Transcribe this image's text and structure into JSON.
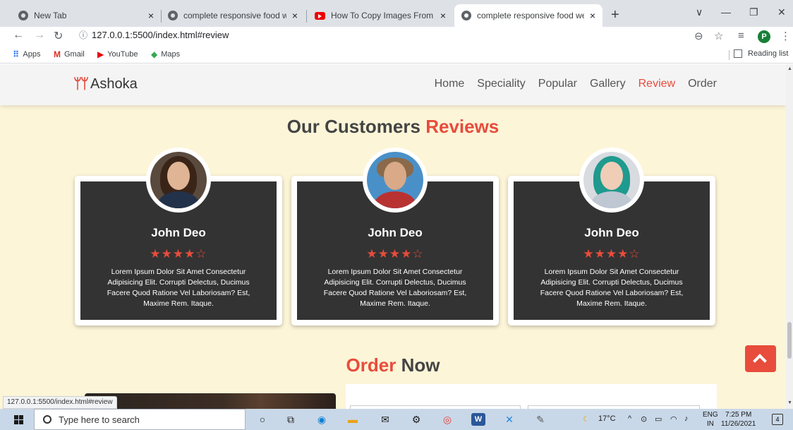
{
  "browser": {
    "tabs": [
      {
        "title": "New Tab",
        "close": "×"
      },
      {
        "title": "complete responsive food websi",
        "close": "×"
      },
      {
        "title": "How To Copy Images From Word",
        "close": "×"
      },
      {
        "title": "complete responsive food websi",
        "close": "×"
      }
    ],
    "new_tab": "+",
    "window_controls": {
      "tab_search": "∨",
      "minimize": "—",
      "restore": "❐",
      "close": "✕"
    },
    "address": "127.0.0.1:5500/index.html#review",
    "bookmarks": [
      {
        "label": "Apps",
        "icon": "apps-grid-icon"
      },
      {
        "label": "Gmail",
        "icon": "gmail-icon"
      },
      {
        "label": "YouTube",
        "icon": "youtube-icon"
      },
      {
        "label": "Maps",
        "icon": "maps-icon"
      }
    ],
    "reading_list": "Reading list",
    "profile_initial": "P",
    "status_url": "127.0.0.1:5500/index.html#review"
  },
  "site": {
    "logo": "Ashoka",
    "menu": [
      "Home",
      "Speciality",
      "Popular",
      "Gallery",
      "Review",
      "Order"
    ],
    "active_menu": "Review",
    "accent_color": "#e74c3c",
    "review_heading": {
      "prefix": "Our Customers",
      "accent": "Reviews"
    },
    "reviews": [
      {
        "name": "John Deo",
        "rating": 4,
        "text": "Lorem Ipsum Dolor Sit Amet Consectetur Adipisicing Elit. Corrupti Delectus, Ducimus Facere Quod Ratione Vel Laboriosam? Est, Maxime Rem. Itaque."
      },
      {
        "name": "John Deo",
        "rating": 4,
        "text": "Lorem Ipsum Dolor Sit Amet Consectetur Adipisicing Elit. Corrupti Delectus, Ducimus Facere Quod Ratione Vel Laboriosam? Est, Maxime Rem. Itaque."
      },
      {
        "name": "John Deo",
        "rating": 4,
        "text": "Lorem Ipsum Dolor Sit Amet Consectetur Adipisicing Elit. Corrupti Delectus, Ducimus Facere Quod Ratione Vel Laboriosam? Est, Maxime Rem. Itaque."
      }
    ],
    "stars": {
      "full": "★★★★",
      "empty": "☆"
    },
    "order_heading": {
      "accent": "Order",
      "suffix": "Now"
    }
  },
  "taskbar": {
    "search_placeholder": "Type here to search",
    "weather": "17°C",
    "language": {
      "line1": "ENG",
      "line2": "IN"
    },
    "time": "7:25 PM",
    "date": "11/26/2021",
    "notifications": "4"
  }
}
